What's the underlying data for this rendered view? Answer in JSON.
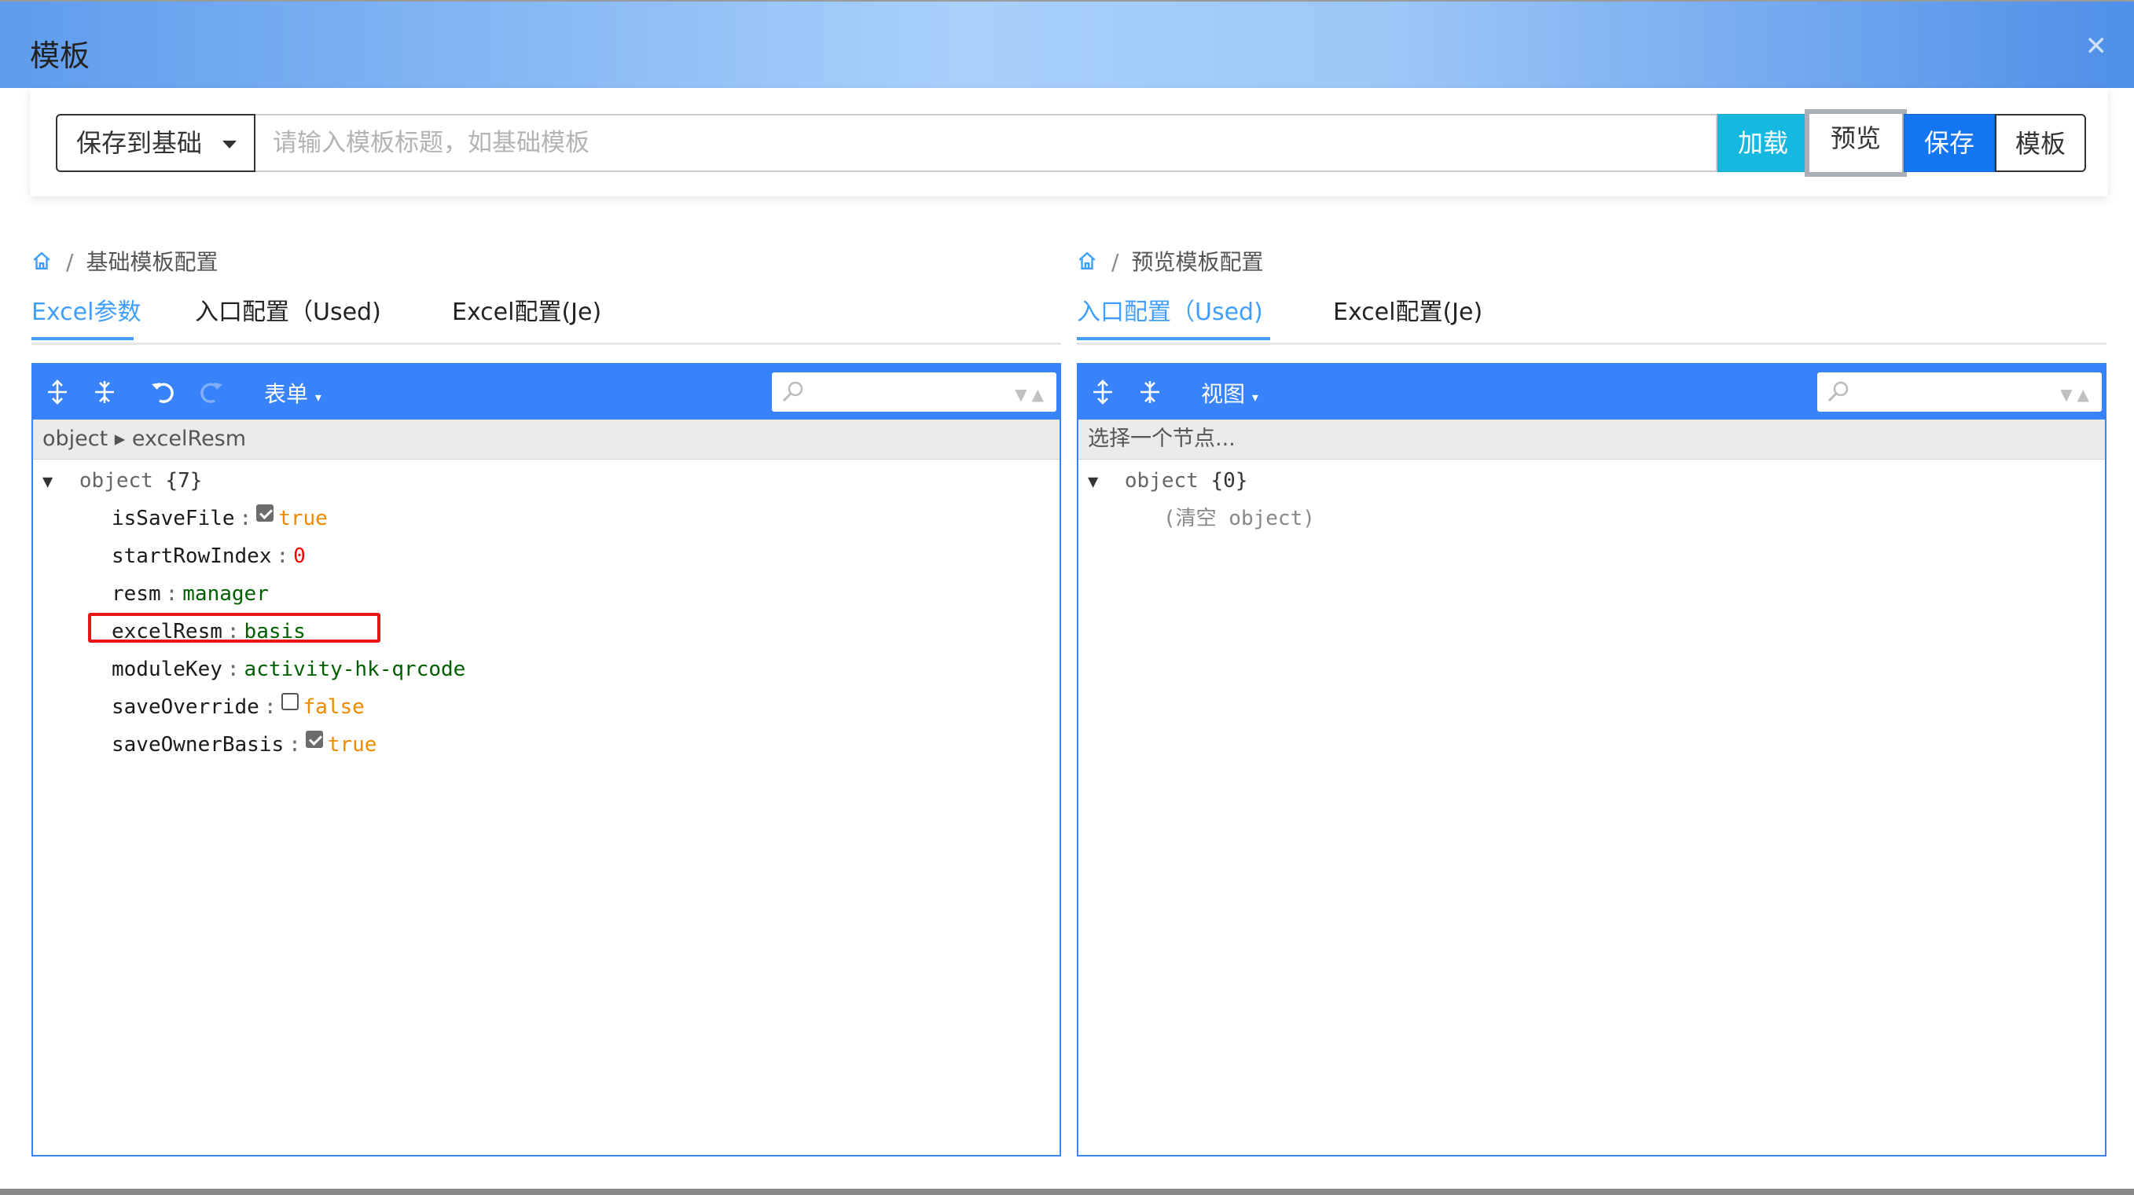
{
  "dialog": {
    "title": "模板",
    "close_icon": "close-icon"
  },
  "toolbar": {
    "save_target": "保存到基础",
    "title_placeholder": "请输入模板标题，如基础模板",
    "title_value": "",
    "buttons": {
      "load": "加载",
      "preview": "预览",
      "save": "保存",
      "template": "模板"
    }
  },
  "left_panel": {
    "breadcrumb": "基础模板配置",
    "tabs": [
      "Excel参数",
      "入口配置（Used)",
      "Excel配置(Je)"
    ],
    "active_tab": 0,
    "editor": {
      "menu": "表单",
      "nav_path": "object ▸ excelResm",
      "root_label": "object",
      "root_count": "{7}",
      "fields": [
        {
          "key": "isSaveFile",
          "type": "bool",
          "value": "true",
          "checked": true
        },
        {
          "key": "startRowIndex",
          "type": "num",
          "value": "0"
        },
        {
          "key": "resm",
          "type": "str",
          "value": "manager"
        },
        {
          "key": "excelResm",
          "type": "str",
          "value": "basis",
          "highlighted": true
        },
        {
          "key": "moduleKey",
          "type": "str",
          "value": "activity-hk-qrcode"
        },
        {
          "key": "saveOverride",
          "type": "bool",
          "value": "false",
          "checked": false
        },
        {
          "key": "saveOwnerBasis",
          "type": "bool",
          "value": "true",
          "checked": true
        }
      ]
    }
  },
  "right_panel": {
    "breadcrumb": "预览模板配置",
    "tabs": [
      "入口配置（Used)",
      "Excel配置(Je)"
    ],
    "active_tab": 0,
    "editor": {
      "menu": "视图",
      "nav_path": "选择一个节点...",
      "root_label": "object",
      "root_count": "{0}",
      "empty_text": "(清空 object)"
    }
  },
  "colors": {
    "editor_blue": "#3883fa",
    "tab_active": "#409eff",
    "highlight": "#e81515"
  }
}
